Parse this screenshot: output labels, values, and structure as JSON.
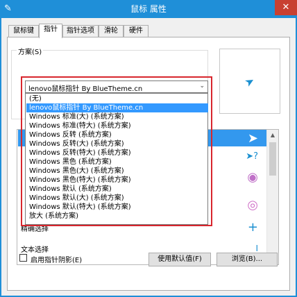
{
  "window": {
    "title": "鼠标 属性",
    "close_glyph": "✕",
    "app_glyph": "✎"
  },
  "tabs": [
    {
      "label": "鼠标键"
    },
    {
      "label": "指针"
    },
    {
      "label": "指针选项"
    },
    {
      "label": "滑轮"
    },
    {
      "label": "硬件"
    }
  ],
  "scheme": {
    "group_label": "方案(S)",
    "selected": "lenovo鼠标指针 By BlueTheme.cn",
    "arrow_glyph": "⌄",
    "options": [
      "(无)",
      "lenovo鼠标指针 By BlueTheme.cn",
      "Windows 标准(大) (系统方案)",
      "Windows 标准(特大) (系统方案)",
      "Windows 反转 (系统方案)",
      "Windows 反转(大) (系统方案)",
      "Windows 反转(特大) (系统方案)",
      "Windows 黑色 (系统方案)",
      "Windows 黑色(大) (系统方案)",
      "Windows 黑色(特大) (系统方案)",
      "Windows 默认 (系统方案)",
      "Windows 默认(大) (系统方案)",
      "Windows 默认(特大) (系统方案)",
      "放大 (系统方案)"
    ],
    "highlighted_index": 1
  },
  "preview": {
    "cursor_glyph": "➤"
  },
  "cursor_list": {
    "rows": [
      {
        "label": "",
        "icon": "➤"
      },
      {
        "label": "",
        "icon": "➤?"
      },
      {
        "label": "",
        "icon": "◉"
      },
      {
        "label": "",
        "icon": "◎"
      },
      {
        "label": "精确选择",
        "icon": "+"
      },
      {
        "label": "文本选择",
        "icon": "I"
      }
    ],
    "selected_index": 0
  },
  "footer": {
    "shadow_label": "启用指针阴影(E)",
    "default_button": "使用默认值(F)",
    "browse_button": "浏览(B)..."
  },
  "colors": {
    "titlebar": "#1f8fd8",
    "selection": "#3399ff",
    "highlight_box": "#d8262d"
  }
}
